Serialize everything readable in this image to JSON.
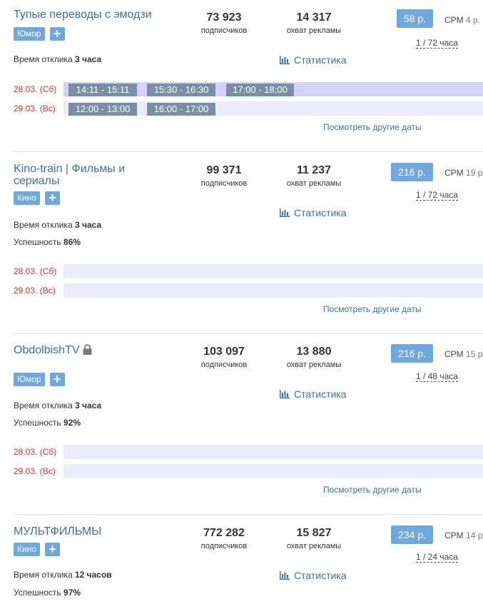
{
  "labels": {
    "subscribers": "подписчиков",
    "reach": "охват рекламы",
    "stats": "Статистика",
    "response_prefix": "Время отклика",
    "success_prefix": "Успешность",
    "other_dates": "Посмотреть другие даты",
    "cpm": "CPM",
    "plus": "+"
  },
  "channels": [
    {
      "title": "Тупые переводы с эмодзи",
      "tag": "Юмор",
      "subscribers": "73 923",
      "reach": "14 317",
      "price": "58 р.",
      "cpm_value": "4 р.",
      "ratio": "1 / 72 часа",
      "response": "3 часа",
      "success": null,
      "locked": false,
      "dates": [
        {
          "label": "28.03. (Сб)",
          "slots": [
            "14:11 - 15:11",
            "15:30 - 16:30",
            "17:00 - 18:00"
          ]
        },
        {
          "label": "29.03. (Вс)",
          "slots": [
            "12:00 - 13:00",
            "16:00 - 17:00"
          ]
        }
      ]
    },
    {
      "title": "Kino-train | Фильмы и сериалы",
      "tag": "Кино",
      "subscribers": "99 371",
      "reach": "11 237",
      "price": "216 р.",
      "cpm_value": "19 р",
      "ratio": "1 / 72 часа",
      "response": "3 часа",
      "success": "86%",
      "locked": false,
      "dates": [
        {
          "label": "28.03. (Сб)",
          "slots": []
        },
        {
          "label": "29.03. (Вс)",
          "slots": []
        }
      ]
    },
    {
      "title": "ObdolbishTV",
      "tag": "Юмор",
      "subscribers": "103 097",
      "reach": "13 880",
      "price": "216 р.",
      "cpm_value": "15 р",
      "ratio": "1 / 48 часа",
      "response": "3 часа",
      "success": "92%",
      "locked": true,
      "dates": [
        {
          "label": "28.03. (Сб)",
          "slots": []
        },
        {
          "label": "29.03. (Вс)",
          "slots": []
        }
      ]
    },
    {
      "title": "МУЛЬТФИЛЬМЫ",
      "tag": "Кино",
      "subscribers": "772 282",
      "reach": "15 827",
      "price": "234 р.",
      "cpm_value": "14 р",
      "ratio": "1 / 24 часа",
      "response": "12 часов",
      "success": "97%",
      "locked": false,
      "dates": []
    }
  ]
}
